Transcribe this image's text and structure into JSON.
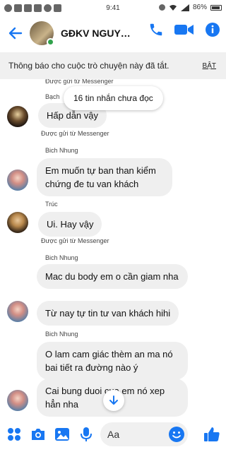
{
  "status_bar": {
    "time": "9:41",
    "battery": "86%"
  },
  "header": {
    "title": "GĐKV NGUYỄN",
    "accent": "#1877f2"
  },
  "notice": {
    "text": "Thông báo cho cuộc trò chuyện này đã tắt.",
    "action": "BẬT"
  },
  "chat": {
    "unread_pill": "16 tin nhắn chưa đọc",
    "sent_via": "Được gửi từ Messenger",
    "partial_name": "Bạch",
    "messages": [
      {
        "sender": "",
        "text": "Hấp dẫn vậy"
      },
      {
        "sender": "Bich Nhung",
        "text": "Em muốn tự ban than kiểm chứng đe tu van khách"
      },
      {
        "sender": "Trúc",
        "text": "Ui. Hay vậy"
      },
      {
        "sender": "Bich Nhung",
        "text": "Mac du body em o cần giam nha"
      },
      {
        "sender": "",
        "text": "Từ nay tự tin tư van khách hihi"
      },
      {
        "sender": "Bich Nhung",
        "text": "O lam cam giác thèm an ma nó bai tiết ra đường nào ý"
      },
      {
        "sender": "",
        "text": "Cai bung  duoi cua em nó xep hẳn nha"
      }
    ]
  },
  "composer": {
    "placeholder": "Aa"
  }
}
